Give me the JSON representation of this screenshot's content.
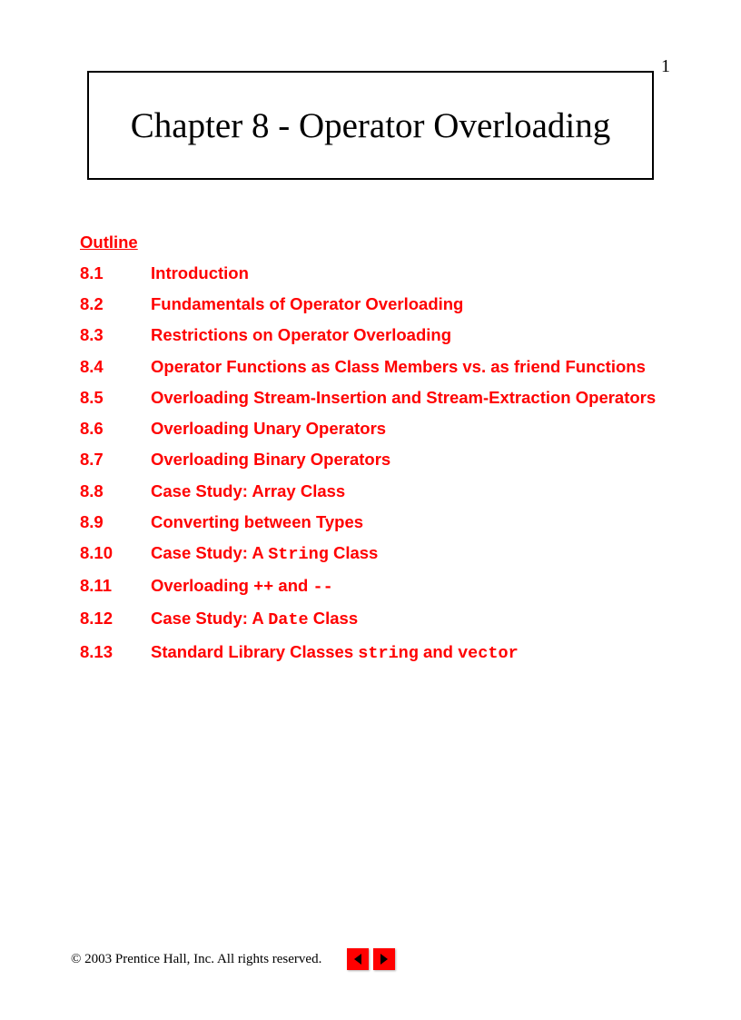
{
  "page_number": "1",
  "title": "Chapter 8 - Operator Overloading",
  "outline_heading": "Outline",
  "outline": [
    {
      "num": "8.1",
      "title": "Introduction"
    },
    {
      "num": "8.2",
      "title": "Fundamentals of Operator Overloading"
    },
    {
      "num": "8.3",
      "title": "Restrictions on Operator Overloading"
    },
    {
      "num": "8.4",
      "title": "Operator Functions as Class Members vs. as friend Functions"
    },
    {
      "num": "8.5",
      "title": "Overloading Stream-Insertion and Stream-Extraction Operators"
    },
    {
      "num": "8.6",
      "title": "Overloading Unary Operators"
    },
    {
      "num": "8.7",
      "title": "Overloading Binary Operators"
    },
    {
      "num": "8.8",
      "title": "Case Study: Array Class"
    },
    {
      "num": "8.9",
      "title": "Converting between Types"
    },
    {
      "num": "8.10",
      "title_parts": [
        "Case Study: A ",
        {
          "code": "String"
        },
        " Class"
      ]
    },
    {
      "num": "8.11",
      "title_parts": [
        "Overloading ",
        {
          "code": "++"
        },
        " and ",
        {
          "code": "--"
        }
      ]
    },
    {
      "num": "8.12",
      "title_parts": [
        "Case Study: A ",
        {
          "code": "Date"
        },
        " Class"
      ]
    },
    {
      "num": "8.13",
      "title_parts": [
        "Standard Library Classes ",
        {
          "code": "string"
        },
        " and ",
        {
          "code": "vector"
        }
      ]
    }
  ],
  "copyright": "© 2003 Prentice Hall, Inc.  All rights reserved."
}
